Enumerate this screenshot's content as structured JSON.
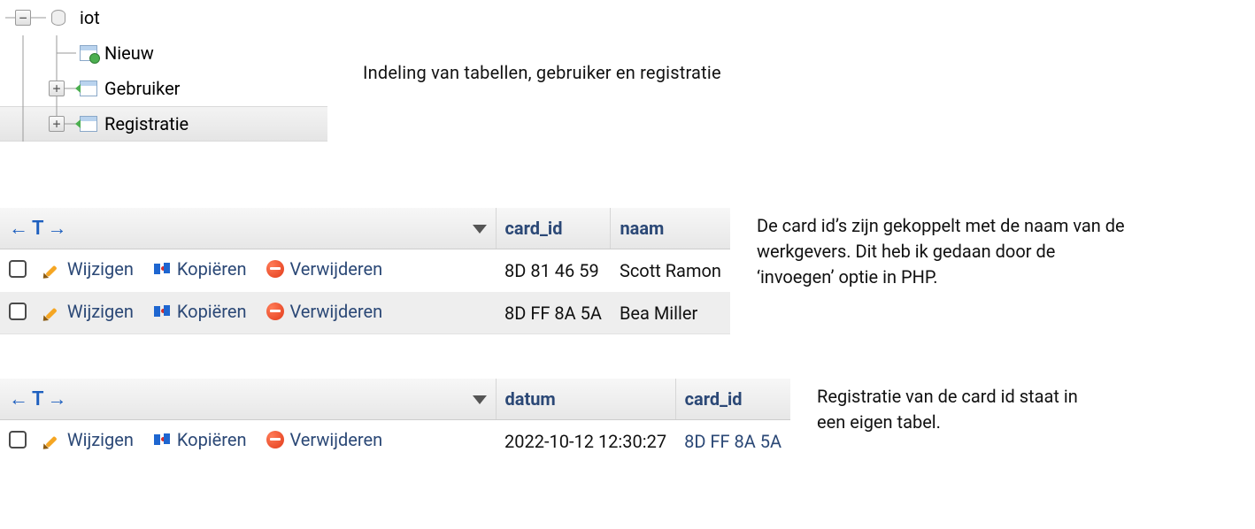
{
  "tree": {
    "db_label": "iot",
    "new_label": "Nieuw",
    "table1_label": "Gebruiker",
    "table2_label": "Registratie"
  },
  "notes": {
    "tree_caption": "Indeling van tabellen, gebruiker en registratie",
    "cards_caption": "De card id’s zijn gekoppelt met de naam van de werkgevers. Dit heb ik gedaan door de ‘invoegen’ optie in PHP.",
    "reg_caption": "Registratie van de card id staat in een eigen tabel."
  },
  "actions": {
    "edit": "Wijzigen",
    "copy": "Kopiëren",
    "delete": "Verwijderen"
  },
  "grid1": {
    "col_cardid": "card_id",
    "col_naam": "naam",
    "rows": [
      {
        "card_id": "8D 81 46 59",
        "naam": "Scott Ramon"
      },
      {
        "card_id": "8D FF 8A 5A",
        "naam": "Bea Miller"
      }
    ]
  },
  "grid2": {
    "col_datum": "datum",
    "col_cardid": "card_id",
    "rows": [
      {
        "datum": "2022-10-12 12:30:27",
        "card_id": "8D FF 8A 5A"
      }
    ]
  }
}
